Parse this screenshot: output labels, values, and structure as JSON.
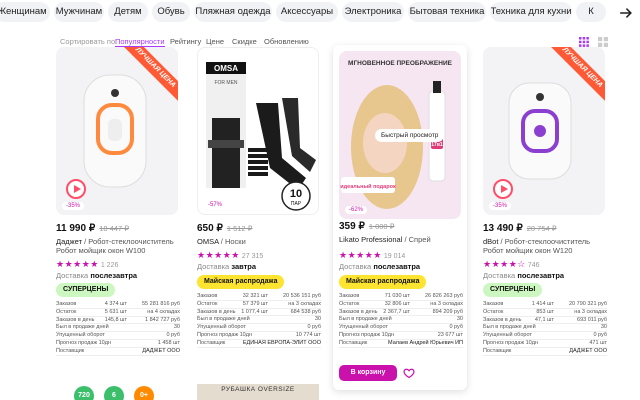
{
  "categories": [
    "Женщинам",
    "Мужчинам",
    "Детям",
    "Обувь",
    "Пляжная одежда",
    "Аксессуары",
    "Электроника",
    "Бытовая техника",
    "Техника для кухни",
    "К"
  ],
  "sort": {
    "label": "Сортировать по:",
    "options": [
      "Популярности",
      "Рейтингу",
      "Цене",
      "Скидке",
      "Обновлению"
    ],
    "active": "Популярности"
  },
  "products": [
    {
      "ribbon": "ЛУЧШАЯ ЦЕНА",
      "discount": "-35%",
      "price": "11 990 ₽",
      "old_price": "18 447 ₽",
      "brand": "Даджет",
      "name": "Робот-стеклоочиститель Робот мойщик окон W100",
      "rating_stars": "★★★★★",
      "rating_count": "1 226",
      "delivery_label": "Доставка",
      "delivery_value": "послезавтра",
      "promo": "СУПЕРЦЕНЫ",
      "stats": [
        [
          "Заказов",
          "4 374 шт",
          "55 281 816 руб"
        ],
        [
          "Остаток",
          "5 631 шт",
          "на 4 складах"
        ],
        [
          "Заказов в день",
          "145,8 шт",
          "1 842 727 руб"
        ],
        [
          "Был в продаже дней",
          "",
          "30"
        ],
        [
          "Упущенный оборот",
          "",
          "0 руб"
        ],
        [
          "Прогноз продаж 10дн",
          "",
          "1 458 шт"
        ],
        [
          "Поставщик",
          "",
          "ДАДЖЕТ ООО"
        ]
      ]
    },
    {
      "ribbon": "",
      "discount": "-57%",
      "price": "650 ₽",
      "old_price": "1 512 ₽",
      "brand": "OMSA",
      "name": "Носки",
      "pack_badge_number": "10",
      "pack_badge_unit": "ПАР",
      "brand_logo": "OMSA",
      "brand_tag": "FOR MEN",
      "rating_stars": "★★★★★",
      "rating_count": "27 315",
      "delivery_label": "Доставка",
      "delivery_value": "завтра",
      "promo": "Майская распродажа",
      "stats": [
        [
          "Заказов",
          "32 321 шт",
          "20 536 151 руб"
        ],
        [
          "Остаток",
          "57 379 шт",
          "на 3 складах"
        ],
        [
          "Заказов в день",
          "1 077,4 шт",
          "684 538 руб"
        ],
        [
          "Был в продаже дней",
          "",
          "30"
        ],
        [
          "Упущенный оборот",
          "",
          "0 руб"
        ],
        [
          "Прогноз продаж 10дн",
          "",
          "10 774 шт"
        ],
        [
          "Поставщик",
          "",
          "ЕДИНАЯ ЕВРОПА-ЭЛИТ ООО"
        ]
      ]
    },
    {
      "ribbon": "",
      "discount": "-62%",
      "price": "359 ₽",
      "old_price": "1 000 ₽",
      "brand": "Likato Professional",
      "name": "Спрей",
      "pic_heading": "МГНОВЕННОЕ ПРЕОБРАЖЕНИЕ",
      "pic_quickview": "Быстрый просмотр",
      "pic_gift": "идеальный подарок",
      "pic_badge": "17в1",
      "rating_stars": "★★★★★",
      "rating_count": "19 014",
      "delivery_label": "Доставка",
      "delivery_value": "послезавтра",
      "promo": "Майская распродажа",
      "stats": [
        [
          "Заказов",
          "71 030 шт",
          "26 826 263 руб"
        ],
        [
          "Остаток",
          "32 806 шт",
          "на 3 складах"
        ],
        [
          "Заказов в день",
          "2 367,7 шт",
          "894 209 руб"
        ],
        [
          "Был в продаже дней",
          "",
          "30"
        ],
        [
          "Упущенный оборот",
          "",
          "0 руб"
        ],
        [
          "Прогноз продаж 10дн",
          "",
          "23 677 шт"
        ],
        [
          "Поставщик",
          "",
          "Малаев Андрей Юрьевич ИП"
        ]
      ],
      "cart_label": "В корзину"
    },
    {
      "ribbon": "ЛУЧШАЯ ЦЕНА",
      "discount": "-35%",
      "price": "13 490 ₽",
      "old_price": "20 754 ₽",
      "brand": "dBot",
      "name": "Робот-стеклоочиститель Робот мойщик окон W120",
      "rating_stars": "★★★★☆",
      "rating_count": "746",
      "delivery_label": "Доставка",
      "delivery_value": "послезавтра",
      "promo": "СУПЕРЦЕНЫ",
      "stats": [
        [
          "Заказов",
          "1 414 шт",
          "20 790 321 руб"
        ],
        [
          "Остаток",
          "853 шт",
          "на 3 складах"
        ],
        [
          "Заказов в день",
          "47,1 шт",
          "693 011 руб"
        ],
        [
          "Был в продаже дней",
          "",
          "30"
        ],
        [
          "Упущенный оборот",
          "",
          "0 руб"
        ],
        [
          "Прогноз продаж 10дн",
          "",
          "471 шт"
        ],
        [
          "Поставщик",
          "",
          "ДАДЖЕТ ООО"
        ]
      ]
    }
  ],
  "bottom_badges": [
    "720",
    "6",
    "0+"
  ],
  "bottom_banner": "РУБАШКА OVERSIZE",
  "colors": {
    "accent": "#cb11ab",
    "sort_active": "#a73afd",
    "ribbon": "#ff5a35",
    "promo_green": "#cdf7c1",
    "promo_yellow": "#fde431"
  }
}
